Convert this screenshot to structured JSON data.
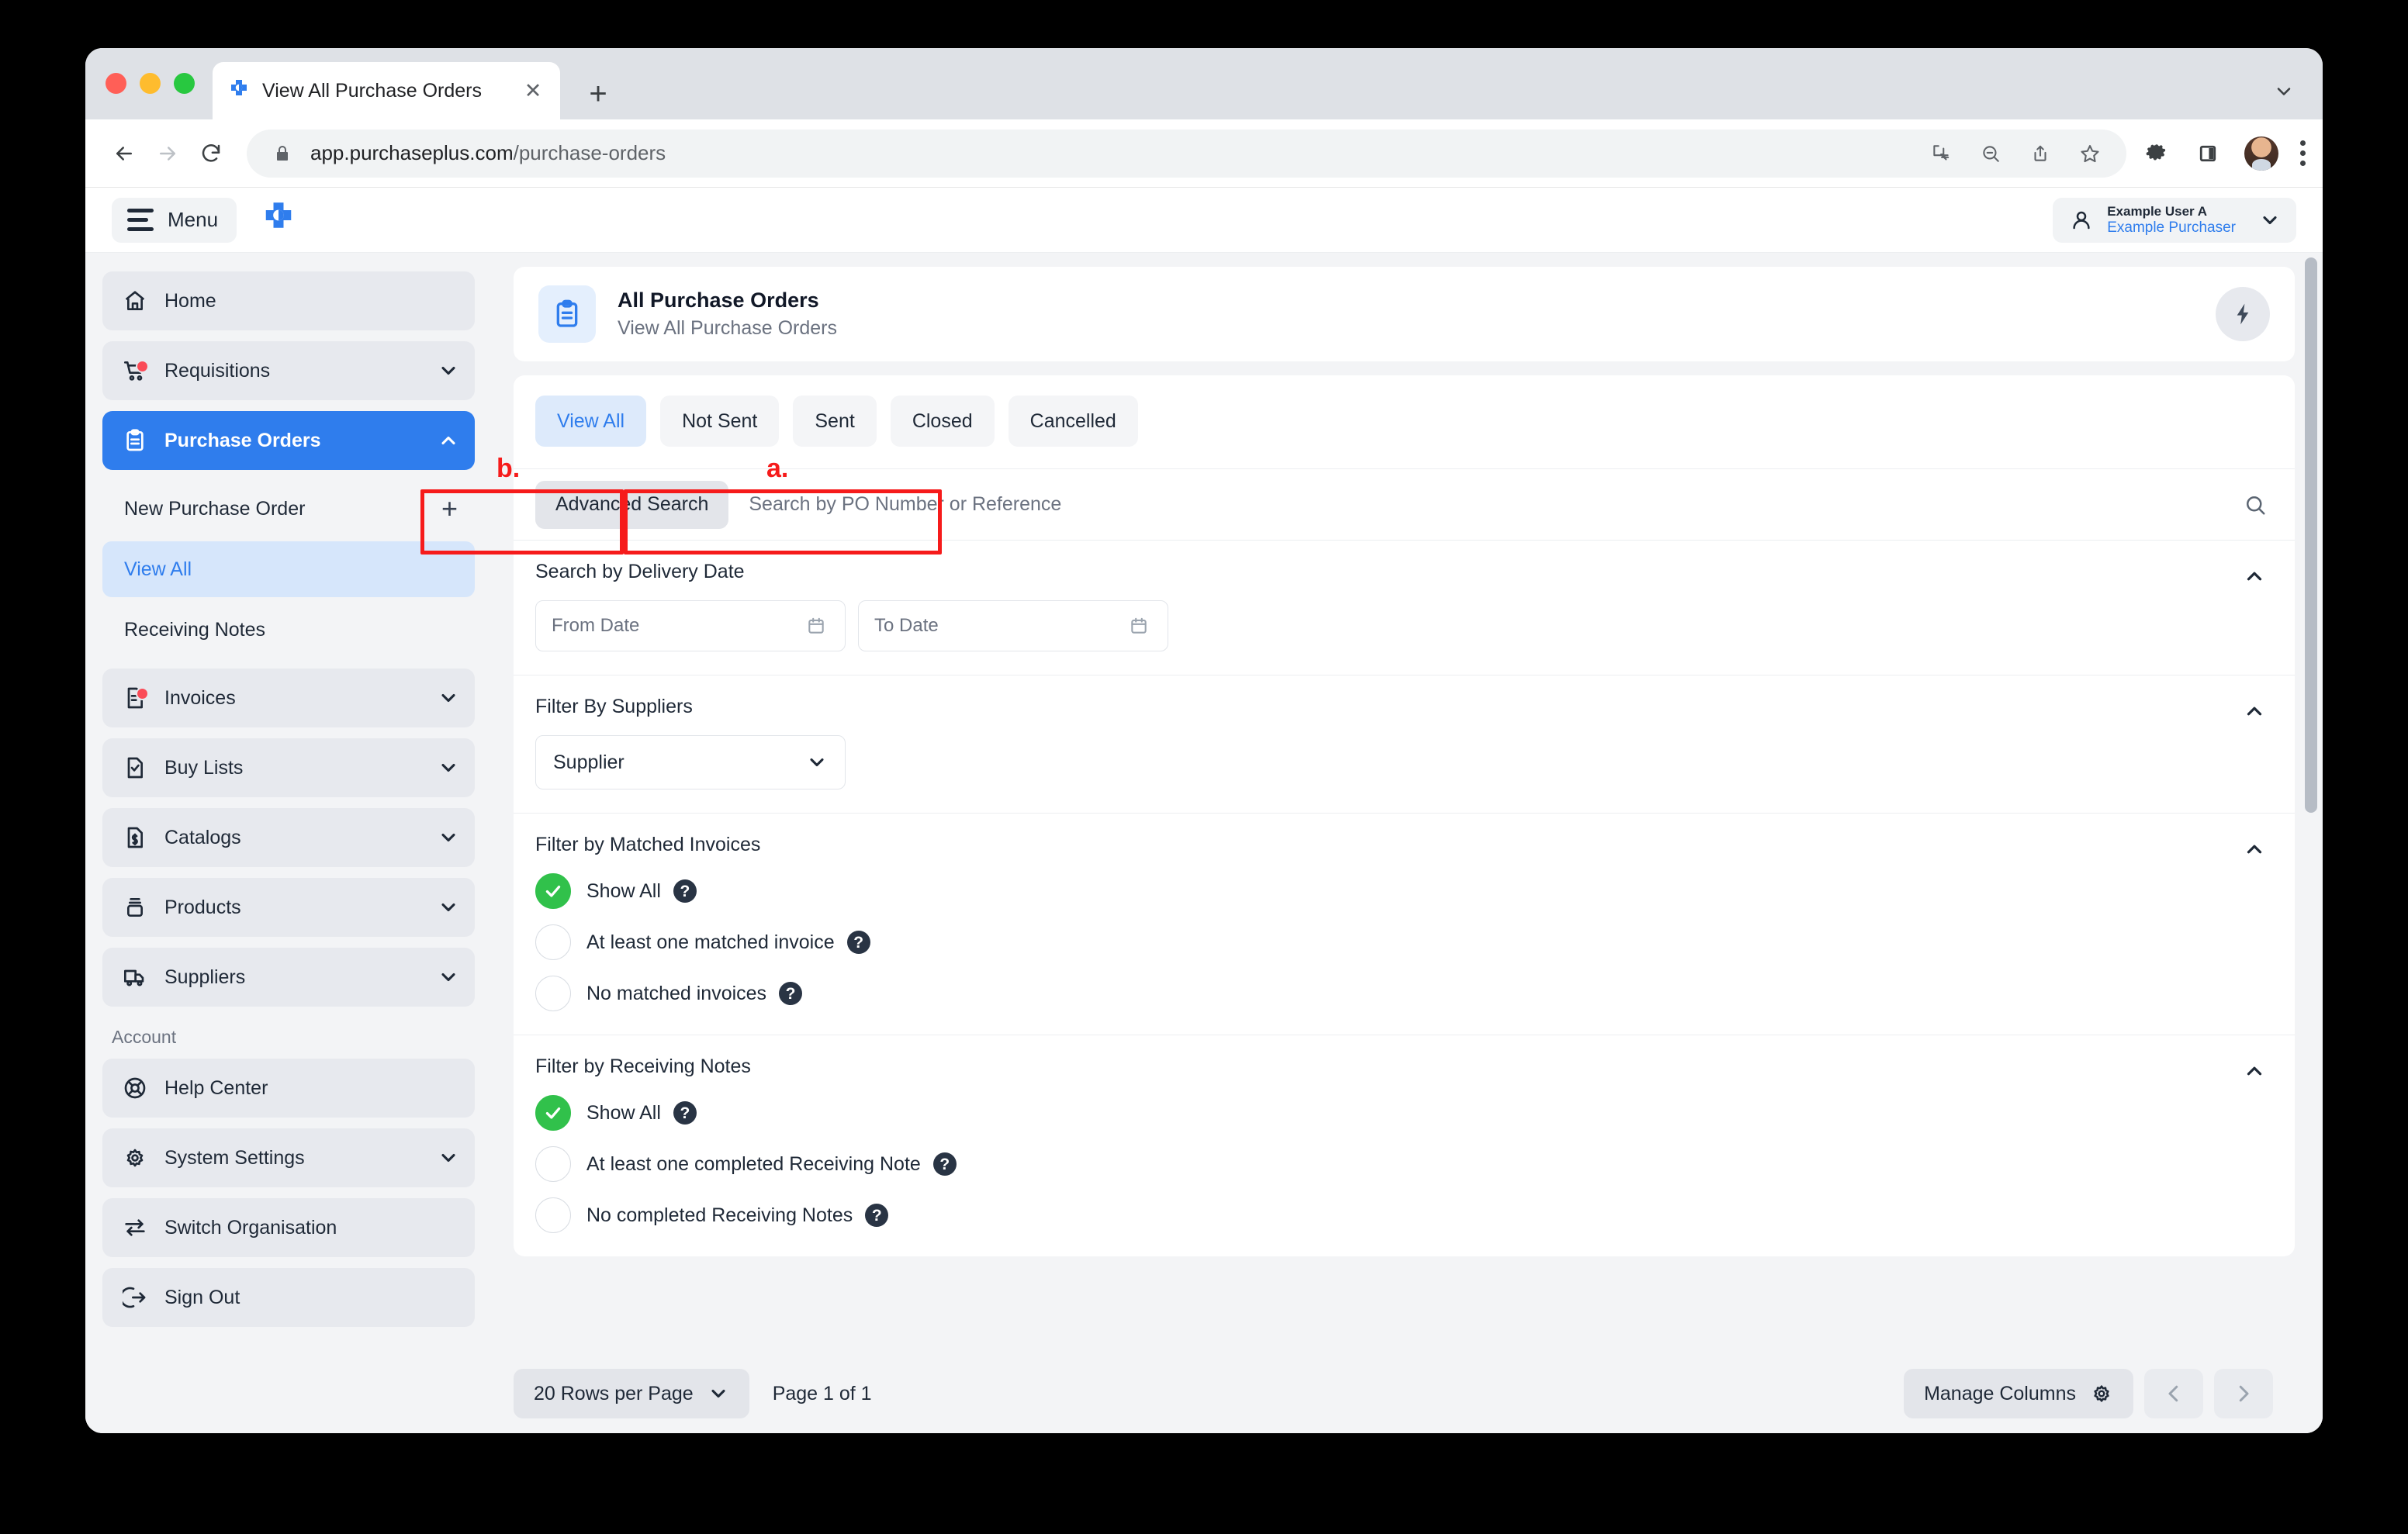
{
  "browser": {
    "tab_title": "View All Purchase Orders",
    "close_glyph": "✕",
    "new_tab_glyph": "+",
    "url_host": "app.purchaseplus.com",
    "url_path": "/purchase-orders"
  },
  "app_header": {
    "menu_label": "Menu",
    "user_name": "Example User A",
    "user_role": "Example Purchaser"
  },
  "sidebar": {
    "items": [
      {
        "label": "Home",
        "icon": "home-icon",
        "caret": false,
        "badge": false
      },
      {
        "label": "Requisitions",
        "icon": "cart-icon",
        "caret": true,
        "badge": true
      },
      {
        "label": "Purchase Orders",
        "icon": "clipboard-icon",
        "caret": true,
        "badge": false,
        "active": true
      }
    ],
    "subitems": [
      {
        "label": "New Purchase Order",
        "plus": "+"
      },
      {
        "label": "View All",
        "selected": true
      },
      {
        "label": "Receiving Notes"
      }
    ],
    "items2": [
      {
        "label": "Invoices",
        "icon": "invoice-icon",
        "caret": true,
        "badge": true
      },
      {
        "label": "Buy Lists",
        "icon": "checklist-icon",
        "caret": true,
        "badge": false
      },
      {
        "label": "Catalogs",
        "icon": "dollar-doc-icon",
        "caret": true,
        "badge": false
      },
      {
        "label": "Products",
        "icon": "box-icon",
        "caret": true,
        "badge": false
      },
      {
        "label": "Suppliers",
        "icon": "truck-icon",
        "caret": true,
        "badge": false
      }
    ],
    "account_heading": "Account",
    "account_items": [
      {
        "label": "Help Center",
        "icon": "lifebuoy-icon",
        "caret": false
      },
      {
        "label": "System Settings",
        "icon": "gear-icon",
        "caret": true
      },
      {
        "label": "Switch Organisation",
        "icon": "swap-arrows-icon",
        "caret": false
      },
      {
        "label": "Sign Out",
        "icon": "sign-out-icon",
        "caret": false
      }
    ]
  },
  "page": {
    "title": "All Purchase Orders",
    "subtitle": "View All Purchase Orders"
  },
  "tabs": [
    {
      "label": "View All",
      "active": true
    },
    {
      "label": "Not Sent",
      "active": false
    },
    {
      "label": "Sent",
      "active": false
    },
    {
      "label": "Closed",
      "active": false
    },
    {
      "label": "Cancelled",
      "active": false
    }
  ],
  "search": {
    "advanced_label": "Advanced Search",
    "placeholder": "Search by PO Number or Reference",
    "value": ""
  },
  "filters": {
    "delivery_date": {
      "title": "Search by Delivery Date",
      "from_placeholder": "From Date",
      "from_value": "",
      "to_placeholder": "To Date",
      "to_value": ""
    },
    "suppliers": {
      "title": "Filter By Suppliers",
      "selected": "Supplier"
    },
    "matched_invoices": {
      "title": "Filter by Matched Invoices",
      "options": [
        {
          "label": "Show All",
          "checked": true,
          "help": "?"
        },
        {
          "label": "At least one matched invoice",
          "checked": false,
          "help": "?"
        },
        {
          "label": "No matched invoices",
          "checked": false,
          "help": "?"
        }
      ]
    },
    "receiving_notes": {
      "title": "Filter by Receiving Notes",
      "options": [
        {
          "label": "Show All",
          "checked": true,
          "help": "?"
        },
        {
          "label": "At least one completed Receiving Note",
          "checked": false,
          "help": "?"
        },
        {
          "label": "No completed Receiving Notes",
          "checked": false,
          "help": "?"
        }
      ]
    }
  },
  "footer": {
    "rows_per_page": "20 Rows per Page",
    "page_count": "Page 1 of 1",
    "manage_columns": "Manage Columns"
  },
  "annotations": [
    {
      "id": "b",
      "label": "b."
    },
    {
      "id": "a",
      "label": "a."
    }
  ],
  "colors": {
    "accent": "#2f7ded",
    "annotation": "#f61b1b",
    "checked_green": "#31c14b",
    "badge_red": "#fa4b57"
  }
}
